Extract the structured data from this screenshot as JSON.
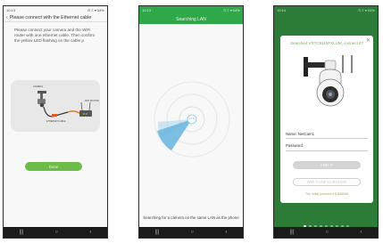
{
  "phone1": {
    "status_time": "10:13",
    "status_right": "⊙ ≡ ▾ 54%",
    "back_icon": "‹",
    "header_title": "Please connect with the Ethernet cable",
    "instructions": "Please connect your camera and the WiFi router with one ethernet cable. Then confirm the yellow LED flashing on the cable p",
    "diagram_labels": {
      "camera": "CAMERA",
      "cable": "ETHERNET CABLE",
      "router": "WIFI ROUTER"
    },
    "next_button": "Done"
  },
  "phone2": {
    "status_time": "10:13",
    "status_right": "⊙ ≡ ▾ 54%",
    "header_title": "Searching LAN",
    "center_label": "LAN",
    "search_text": "Searching for a camera on the same LAN as the phone"
  },
  "phone3": {
    "status_time": "10:14",
    "status_right": "⊙ ≡ ▾ 54%",
    "found_text": "Searched VSTC8110FXLUM, connect it?",
    "close_icon": "✕",
    "name_label": "Name: NetCam1",
    "password_label": "Password:",
    "add_button": "ADD IT",
    "wifi_config_button": "WIFI CONFIGURATION",
    "default_password_note": "The initial password is 888888",
    "page_count": 9,
    "active_page": 0
  },
  "nav_icons": [
    "recent-apps-icon",
    "home-icon",
    "back-icon"
  ],
  "nav_glyphs": [
    "|||",
    "○",
    "‹"
  ],
  "colors": {
    "green": "#2fa84a",
    "dark_green": "#2c7b36",
    "button_green": "#6dbb4a"
  }
}
